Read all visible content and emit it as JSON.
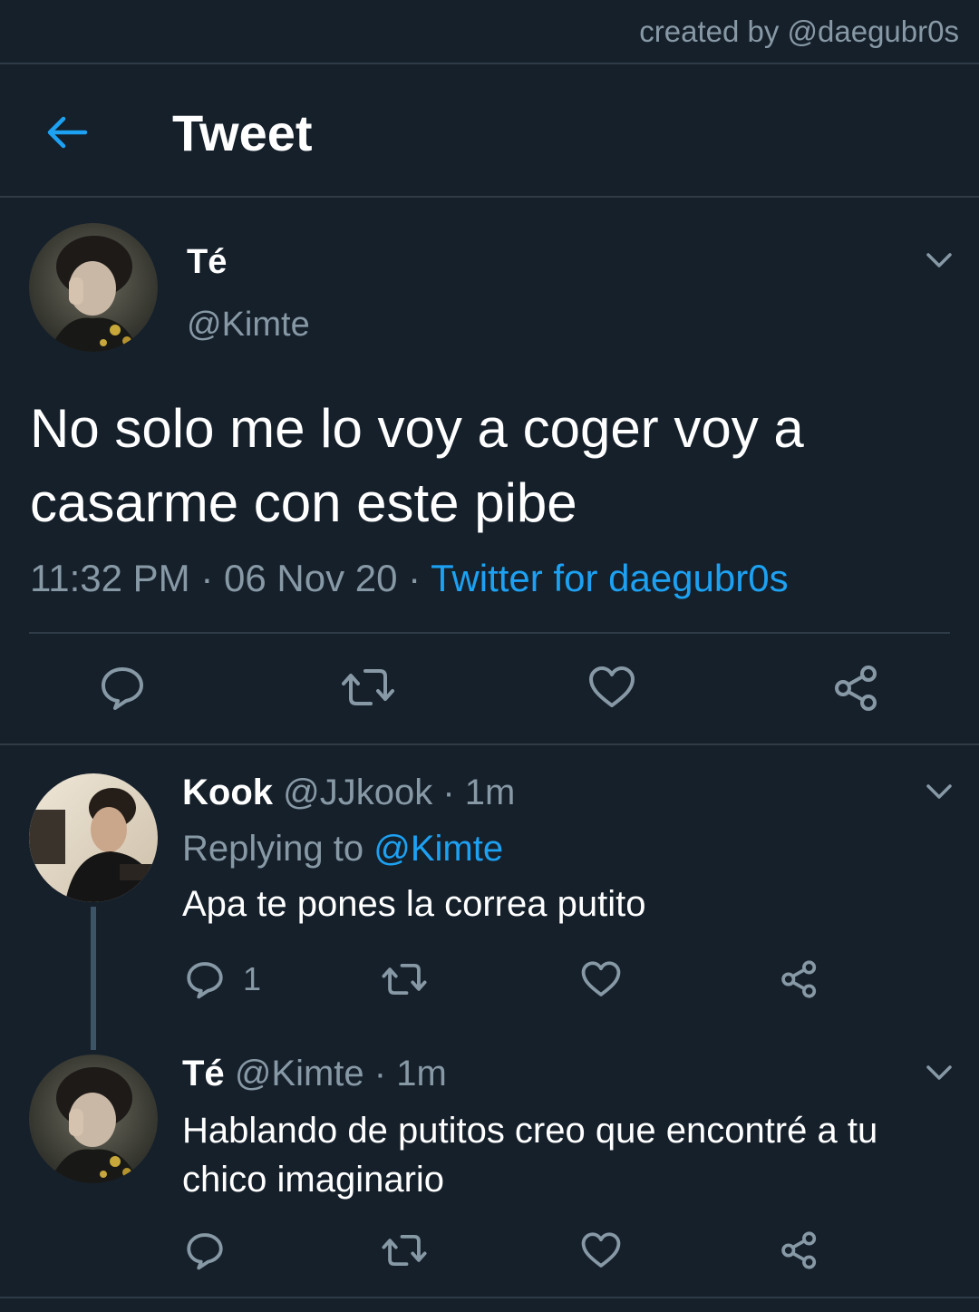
{
  "watermark": "created by @daegubr0s",
  "header": {
    "title": "Tweet",
    "back_icon": "arrow-left-icon"
  },
  "main_tweet": {
    "display_name": "Té",
    "handle": "@Kimte",
    "text_line1": "No solo me lo voy a coger voy a",
    "text_line2": "casarme con este pibe",
    "time": "11:32 PM",
    "sep1": "·",
    "date": "06 Nov 20",
    "sep2": "·",
    "source": "Twitter for daegubr0s",
    "actions": [
      "reply-icon",
      "retweet-icon",
      "like-icon",
      "share-icon"
    ]
  },
  "replies": [
    {
      "display_name": "Kook",
      "handle": "@JJkook",
      "time": "· 1m",
      "replying_prefix": "Replying to",
      "replying_to": "@Kimte",
      "text": "Apa te pones la correa putito",
      "reply_count": "1"
    },
    {
      "display_name": "Té",
      "handle": "@Kimte",
      "time": "· 1m",
      "text_line1": "Hablando de putitos creo que encontré a tu",
      "text_line2": "chico imaginario"
    }
  ],
  "colors": {
    "background": "#15202b",
    "accent": "#1da1f2",
    "muted": "#8899a6",
    "divider": "#2f3b47"
  }
}
